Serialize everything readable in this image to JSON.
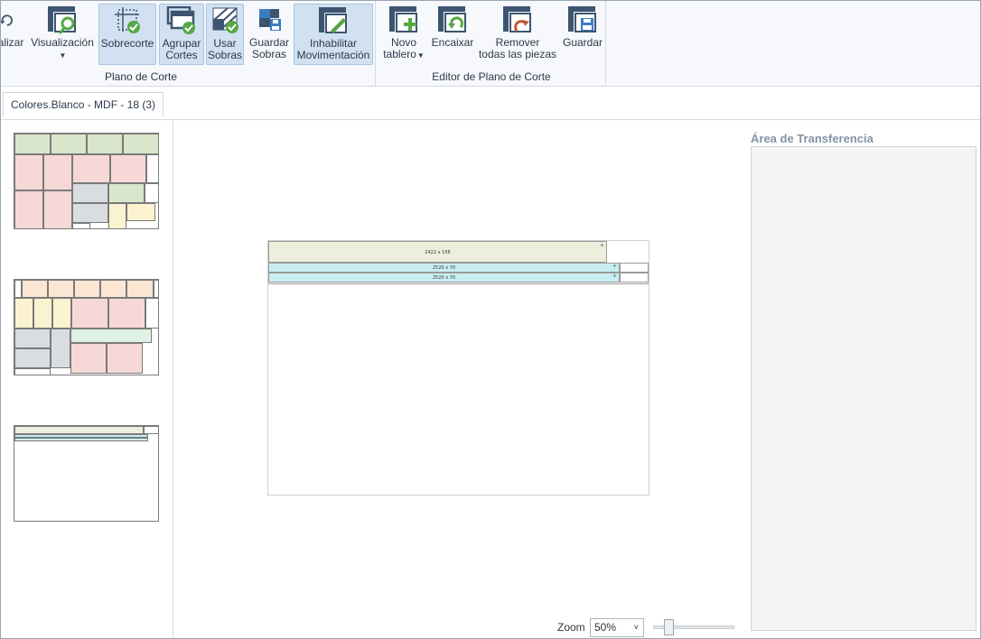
{
  "ribbon": {
    "buttons": {
      "actualizar": "alizar",
      "visualizacion": "Visualización",
      "sobrecorte": "Sobrecorte",
      "agrupar_1": "Agrupar",
      "agrupar_2": "Cortes",
      "usar_1": "Usar",
      "usar_2": "Sobras",
      "guardar_sobras_1": "Guardar",
      "guardar_sobras_2": "Sobras",
      "inhabilitar_1": "Inhabilitar",
      "inhabilitar_2": "Movimentación",
      "novo_1": "Novo",
      "novo_2": "tablero",
      "encaixar": "Encaixar",
      "remover_1": "Remover",
      "remover_2": "todas las piezas",
      "guardar": "Guardar"
    },
    "groups": {
      "plano_de_corte": "Plano de Corte",
      "editor": "Editor de Plano de Corte"
    }
  },
  "tabs": [
    {
      "label": "Colores.Blanco - MDF - 18 (3)"
    }
  ],
  "board": {
    "pieces": [
      {
        "label": "2422 x 156"
      },
      {
        "label": "2520 x 70"
      },
      {
        "label": "2520 x 70"
      }
    ]
  },
  "transfer_area": {
    "title": "Área de Transferencia"
  },
  "zoom": {
    "label": "Zoom",
    "value": "50%"
  },
  "colors": {
    "accent": "#3b6ea5",
    "piece_beige": "#eeeedd",
    "piece_cyan": "#c8eef2",
    "thumb_green": "#d9e6cc",
    "thumb_pink": "#f6d9d6",
    "thumb_gray": "#d9dde0",
    "thumb_yellow": "#fbf3cf",
    "thumb_peach": "#fbe6d4"
  }
}
